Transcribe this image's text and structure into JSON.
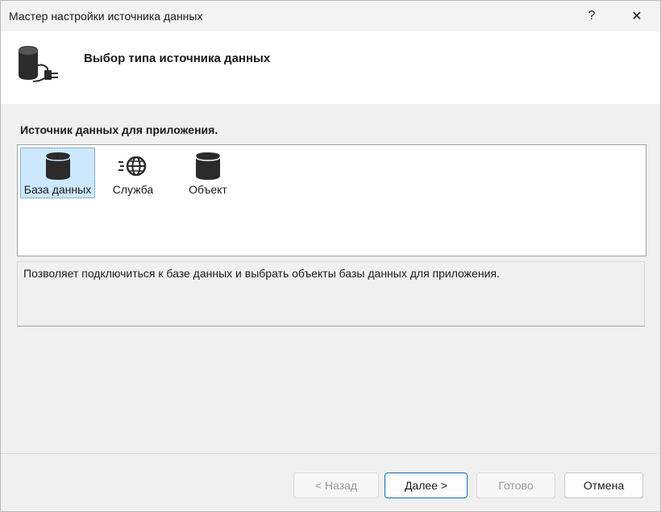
{
  "window": {
    "title": "Мастер настройки источника данных",
    "help_glyph": "?",
    "close_glyph": "✕"
  },
  "header": {
    "title": "Выбор типа источника данных",
    "icon": "database-plug-icon"
  },
  "section_label": "Источник данных для приложения.",
  "data_sources": [
    {
      "label": "База данных",
      "icon": "database-icon",
      "selected": true
    },
    {
      "label": "Служба",
      "icon": "web-service-icon",
      "selected": false
    },
    {
      "label": "Объект",
      "icon": "object-icon",
      "selected": false
    }
  ],
  "description": "Позволяет подключиться к базе данных и выбрать объекты базы данных для приложения.",
  "buttons": {
    "back": "< Назад",
    "next": "Далее >",
    "finish": "Готово",
    "cancel": "Отмена"
  },
  "colors": {
    "selection": "#cce8ff",
    "icon_fill": "#2b2b2b",
    "default_button_border": "#0f6cbd"
  }
}
